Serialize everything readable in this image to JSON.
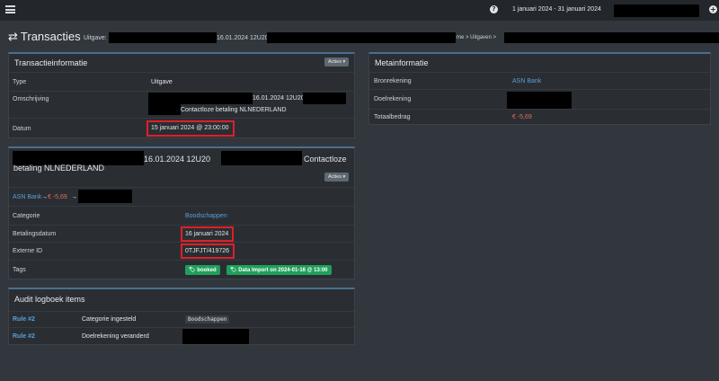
{
  "topbar": {
    "date_range": "1 januari 2024 - 31 januari 2024"
  },
  "header": {
    "title": "Transacties",
    "subtitle_prefix": "Uitgave:",
    "subtitle_mid": "16.01.2024 12U20",
    "breadcrumb": "me  >  Uitgaven  >"
  },
  "transaction_info": {
    "title": "Transactieinformatie",
    "actions_label": "Acties ▾",
    "type_label": "Type",
    "type_value": "Uitgave",
    "description_label": "Omschrijving",
    "description_line1": "16.01.2024 12U20",
    "description_line2": "Contactloze betaling NLNEDERLAND",
    "date_label": "Datum",
    "date_value": "15 januari 2024 @ 23:00:00"
  },
  "meta_info": {
    "title": "Metainformatie",
    "source_label": "Bronrekening",
    "source_value": "ASN Bank",
    "dest_label": "Doelrekening",
    "total_label": "Totaalbedrag",
    "total_value": "€ -5,69"
  },
  "split": {
    "title_mid": "16.01.2024 12U20",
    "title_end": "Contactloze",
    "title_line2": "betaling NLNEDERLAND",
    "actions_label": "Acties ▾",
    "flow_source": "ASN Bank",
    "flow_arrow1": "→",
    "flow_amount": "€ -5,69",
    "flow_arrow2": "→",
    "category_label": "Categorie",
    "category_value": "Boodschappen",
    "payment_date_label": "Betalingsdatum",
    "payment_date_value": "16 januari 2024",
    "external_id_label": "Externe ID",
    "external_id_value": "0TJFJT/419726",
    "tags_label": "Tags",
    "tag1": "booked",
    "tag2": "Data Import on 2024-01-16 @ 13:00"
  },
  "audit": {
    "title": "Audit logboek items",
    "rows": [
      {
        "rule": "Rule #2",
        "action": "Categorie ingesteld",
        "value": "Boodschappen"
      },
      {
        "rule": "Rule #2",
        "action": "Doelrekening veranderd",
        "value": ""
      }
    ]
  },
  "colors": {
    "accent": "#4a6f8f",
    "link": "#5a9fd6",
    "negative": "#e06c5a",
    "tag": "#1fa05a",
    "highlight": "#e01f26"
  }
}
